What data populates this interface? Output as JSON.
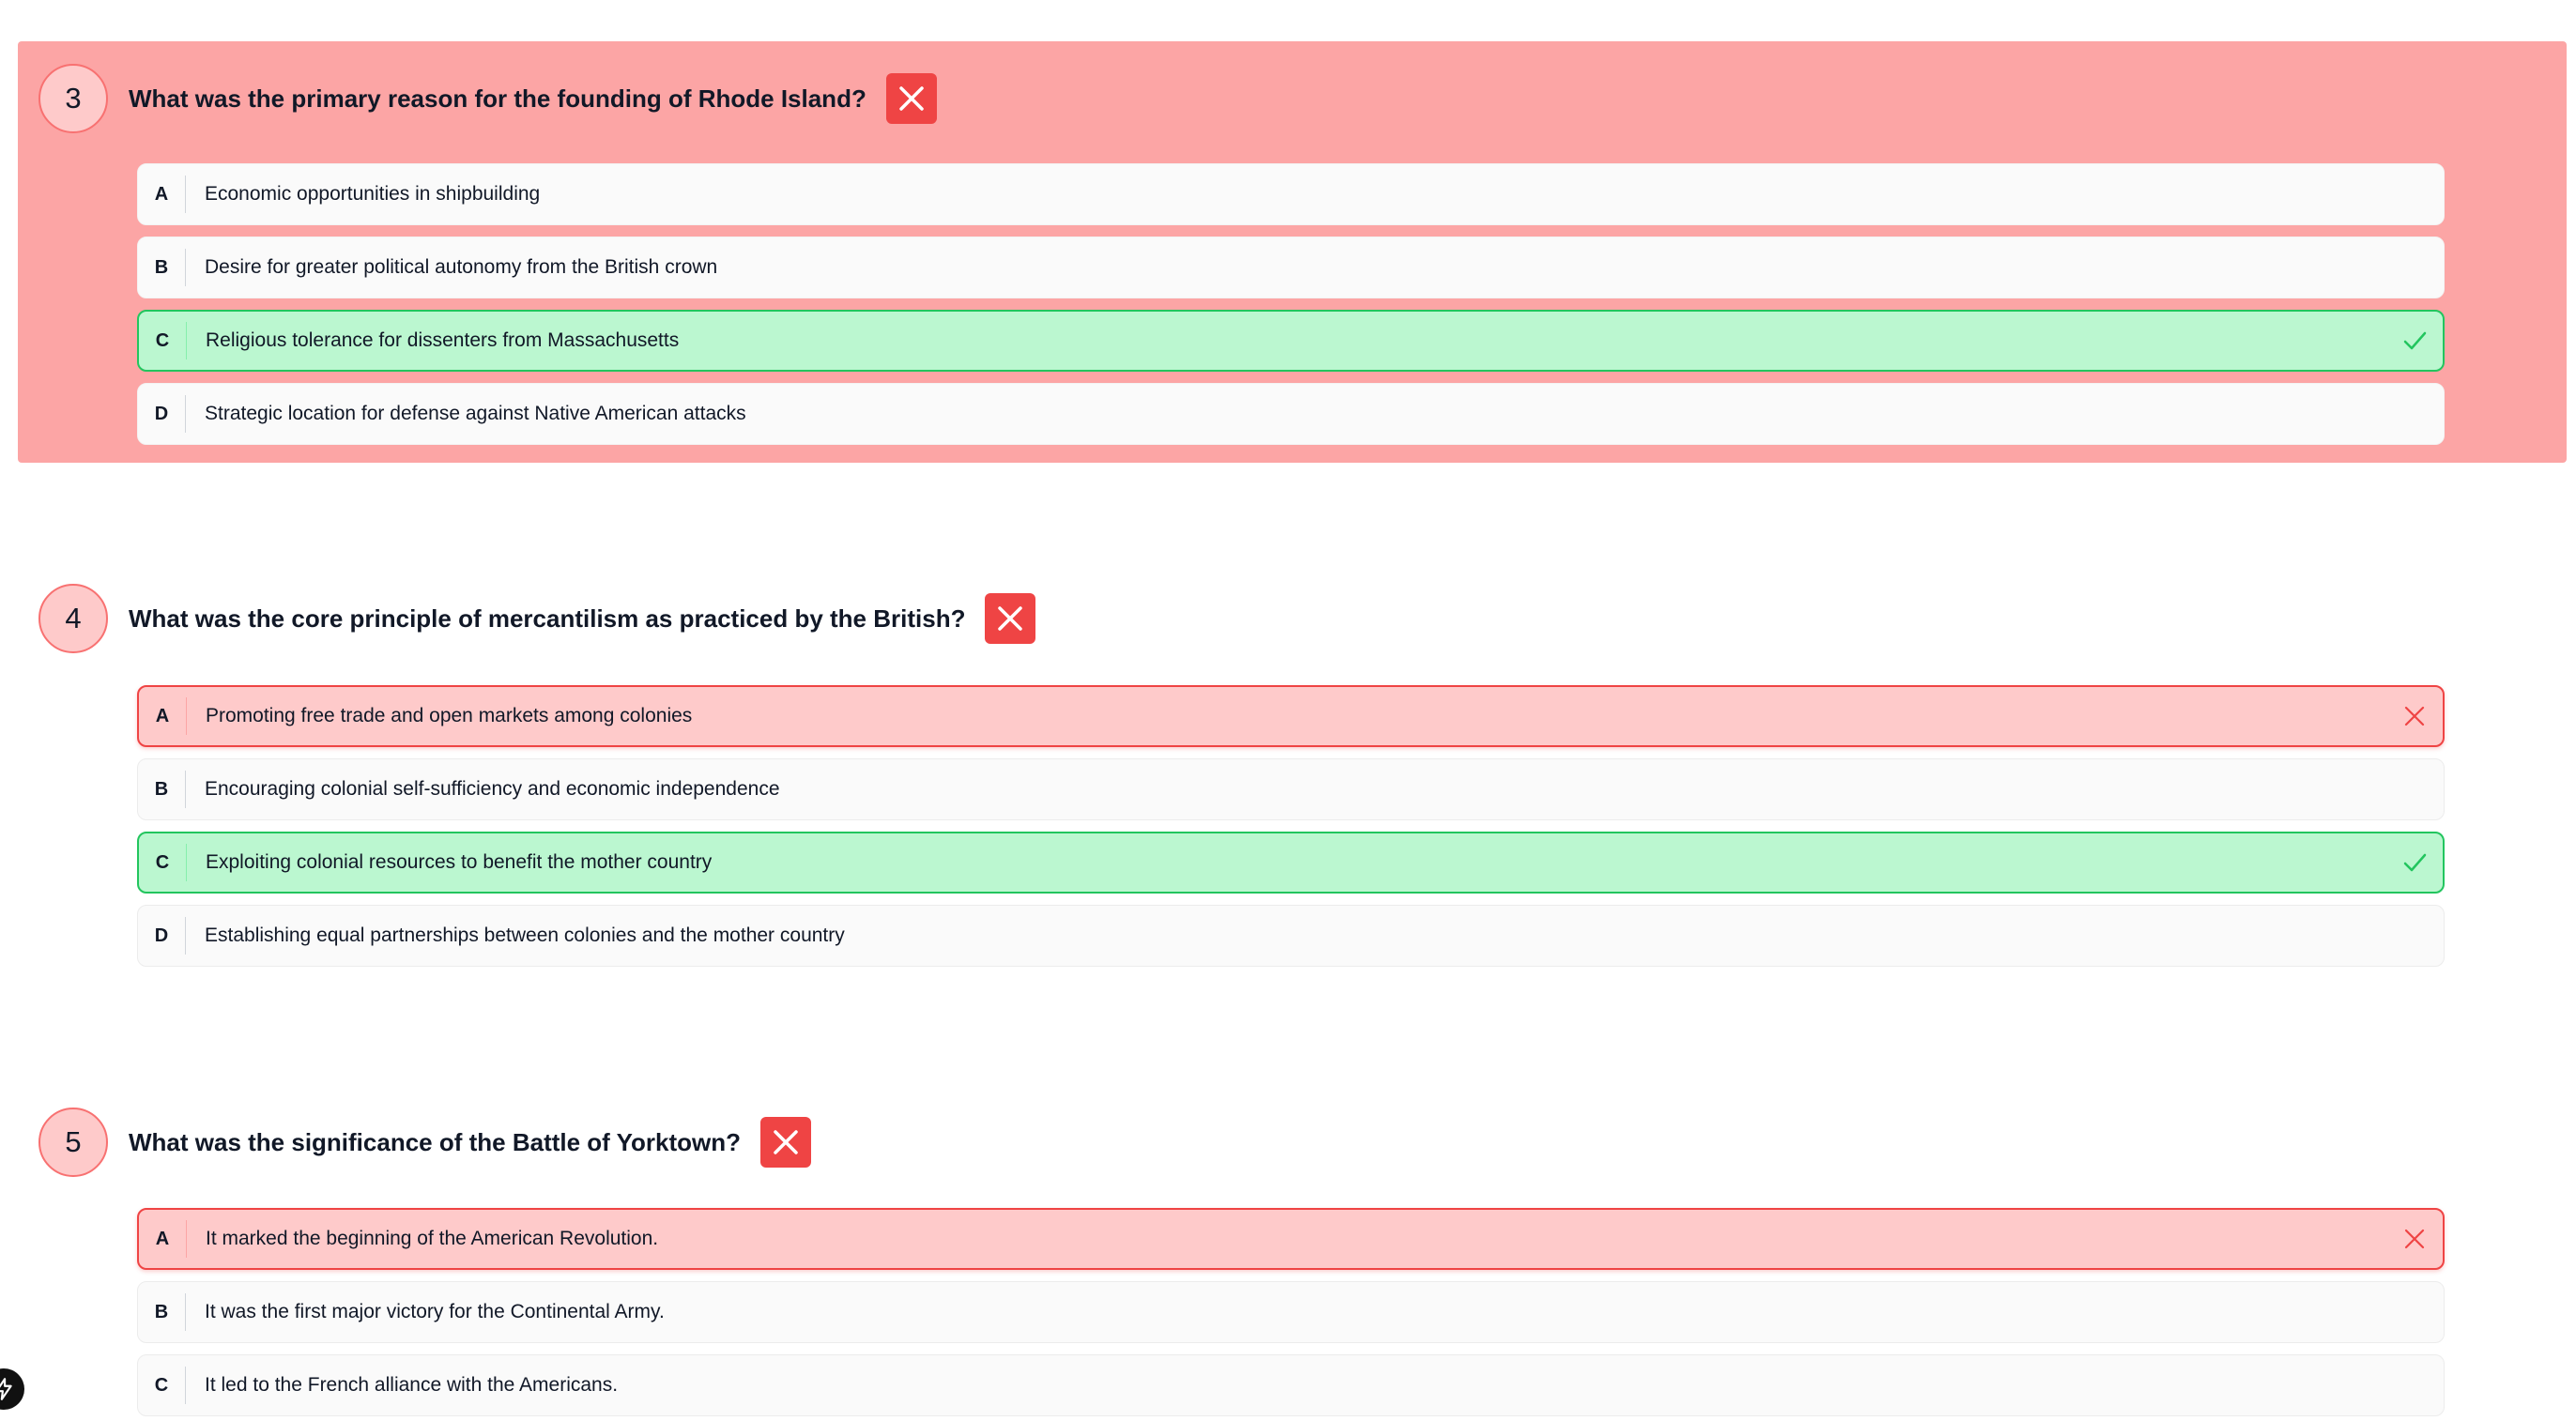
{
  "colors": {
    "highlight_bg": "#fca5a5",
    "correct_bg": "#bbf7d0",
    "correct_border": "#22c55e",
    "wrong_bg": "#fecaca",
    "wrong_border": "#ef4444",
    "status_badge": "#ef4444"
  },
  "questions": [
    {
      "number": "3",
      "text": "What was the primary reason for the founding of Rhode Island?",
      "status_icon": "close-icon",
      "options": [
        {
          "letter": "A",
          "text": "Economic opportunities in shipbuilding",
          "state": "default"
        },
        {
          "letter": "B",
          "text": "Desire for greater political autonomy from the British crown",
          "state": "default"
        },
        {
          "letter": "C",
          "text": "Religious tolerance for dissenters from Massachusetts",
          "state": "correct",
          "icon": "check-icon"
        },
        {
          "letter": "D",
          "text": "Strategic location for defense against Native American attacks",
          "state": "default"
        }
      ]
    },
    {
      "number": "4",
      "text": "What was the core principle of mercantilism as practiced by the British?",
      "status_icon": "close-icon",
      "options": [
        {
          "letter": "A",
          "text": "Promoting free trade and open markets among colonies",
          "state": "wrong",
          "icon": "close-icon"
        },
        {
          "letter": "B",
          "text": "Encouraging colonial self-sufficiency and economic independence",
          "state": "default"
        },
        {
          "letter": "C",
          "text": "Exploiting colonial resources to benefit the mother country",
          "state": "correct",
          "icon": "check-icon"
        },
        {
          "letter": "D",
          "text": "Establishing equal partnerships between colonies and the mother country",
          "state": "default"
        }
      ]
    },
    {
      "number": "5",
      "text": "What was the significance of the Battle of Yorktown?",
      "status_icon": "close-icon",
      "options": [
        {
          "letter": "A",
          "text": "It marked the beginning of the American Revolution.",
          "state": "wrong",
          "icon": "close-icon"
        },
        {
          "letter": "B",
          "text": "It was the first major victory for the Continental Army.",
          "state": "default"
        },
        {
          "letter": "C",
          "text": "It led to the French alliance with the Americans.",
          "state": "default"
        }
      ]
    }
  ],
  "floating_button": {
    "icon": "bolt-icon"
  }
}
